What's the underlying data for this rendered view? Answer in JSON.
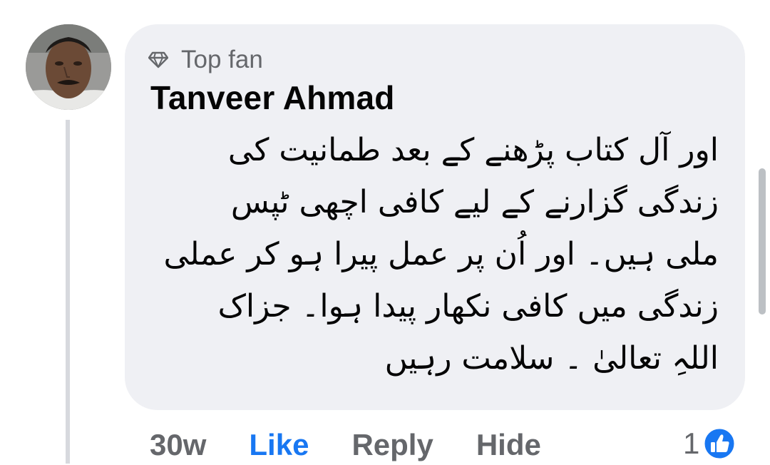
{
  "comment": {
    "badge": {
      "icon": "diamond-icon",
      "label": "Top fan"
    },
    "author": "Tanveer Ahmad",
    "text": "اور آل کتاب پڑھنے کے بعد طمانیت کی\nزندگی گزارنے کے لیے کافی اچھی ٹپس\nملی ہیں۔ اور اُن پر عمل پیرا ہو کر عملی\nزندگی میں کافی نکھار پیدا ہوا۔ جزاک\nاللہِ تعالیٰ ۔ سلامت رہیں",
    "actions": {
      "time": "30w",
      "like": "Like",
      "reply": "Reply",
      "hide": "Hide"
    },
    "reactions": {
      "count": "1",
      "icon": "thumbs-up-icon"
    }
  },
  "colors": {
    "bubble_background": "#eff0f4",
    "secondary_text": "#65676b",
    "accent_blue": "#1877f2",
    "primary_text": "#050505"
  }
}
